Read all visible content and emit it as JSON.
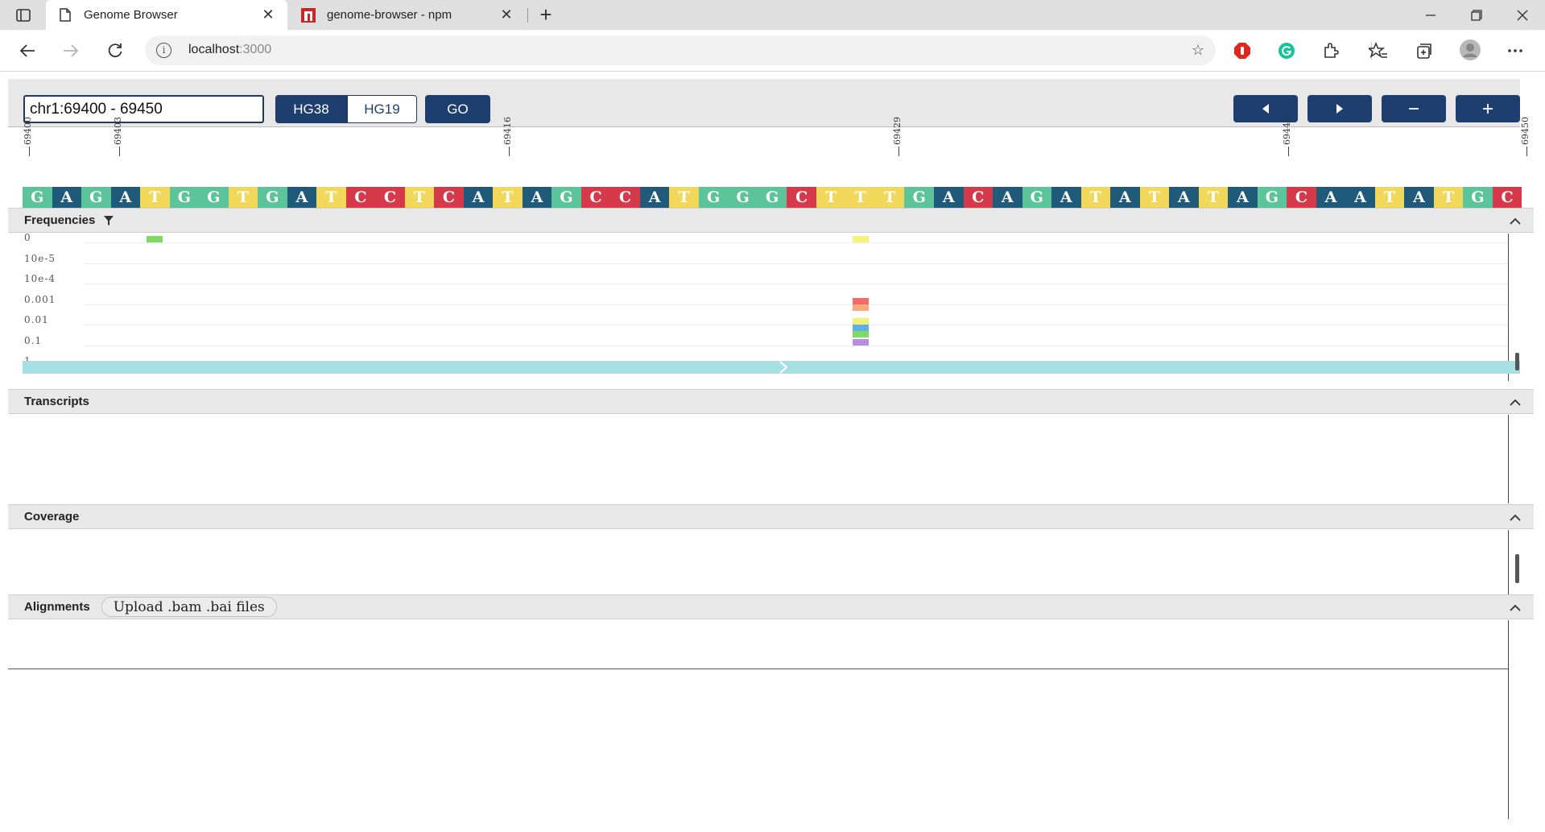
{
  "browser": {
    "tabs": [
      {
        "label": "Genome Browser",
        "active": true
      },
      {
        "label": "genome-browser - npm",
        "active": false
      }
    ],
    "url_host": "localhost",
    "url_port": ":3000"
  },
  "controls": {
    "locus_value": "chr1:69400 - 69450",
    "assemblies": [
      "HG38",
      "HG19"
    ],
    "selected_assembly": "HG38",
    "go_label": "GO",
    "nav": {
      "back": "◀",
      "forward": "▶",
      "zoom_out": "−",
      "zoom_in": "+"
    }
  },
  "ruler": {
    "ticks": [
      "69400",
      "69403",
      "69416",
      "69429",
      "69442",
      "69450"
    ]
  },
  "sequence": "GAGATGGTGATCCTCATAGCCATGGGCTTTGACAGATATATAGCAATATGC",
  "base_colors": {
    "A": "#1f5a7a",
    "C": "#d63a4a",
    "G": "#5cc49a",
    "T": "#f2d85a"
  },
  "panels": {
    "frequencies": {
      "title": "Frequencies",
      "scale_labels": [
        "0",
        "10e-5",
        "10e-4",
        "0.001",
        "0.01",
        "0.1",
        "1"
      ],
      "variants": [
        {
          "position": 69404,
          "color": "#7ddc5f",
          "bin": "0"
        },
        {
          "position": 69428,
          "color": "#f6f27a",
          "bin": "0"
        },
        {
          "position": 69428,
          "color": "#f26b6b",
          "bin": "0.001"
        },
        {
          "position": 69428,
          "color": "#f6a97a",
          "bin": "0.001"
        },
        {
          "position": 69428,
          "color": "#f3f07a",
          "bin": "0.01"
        },
        {
          "position": 69428,
          "color": "#5fb0e8",
          "bin": "0.01"
        },
        {
          "position": 69428,
          "color": "#7ddc5f",
          "bin": "0.01"
        },
        {
          "position": 69428,
          "color": "#b78ee0",
          "bin": "0.1"
        }
      ]
    },
    "transcripts": {
      "title": "Transcripts"
    },
    "coverage": {
      "title": "Coverage"
    },
    "alignments": {
      "title": "Alignments",
      "upload_label": "Upload .bam .bai files"
    }
  }
}
